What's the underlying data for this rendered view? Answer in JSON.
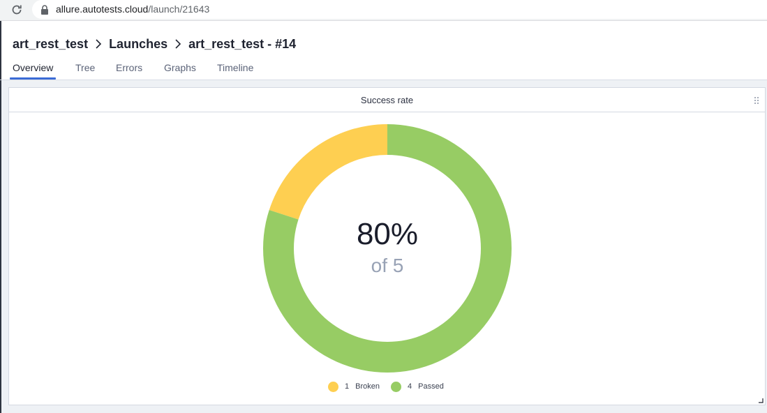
{
  "browser": {
    "url_host": "allure.autotests.cloud",
    "url_path": "/launch/21643"
  },
  "breadcrumb": {
    "items": [
      "art_rest_test",
      "Launches",
      "art_rest_test - #14"
    ]
  },
  "tabs": [
    {
      "label": "Overview",
      "active": true
    },
    {
      "label": "Tree",
      "active": false
    },
    {
      "label": "Errors",
      "active": false
    },
    {
      "label": "Graphs",
      "active": false
    },
    {
      "label": "Timeline",
      "active": false
    }
  ],
  "widget": {
    "title": "Success rate",
    "center_value": "80%",
    "center_sub": "of 5"
  },
  "chart_data": {
    "type": "pie",
    "slices": [
      {
        "name": "Broken",
        "value": 1,
        "color": "#fecf51"
      },
      {
        "name": "Passed",
        "value": 4,
        "color": "#97cc64"
      }
    ],
    "legend": [
      {
        "count": "1",
        "label": "Broken",
        "color": "#fecf51"
      },
      {
        "count": "4",
        "label": "Passed",
        "color": "#97cc64"
      }
    ],
    "legend_placement": "bottom"
  },
  "icons": {
    "reload": "reload-icon",
    "lock": "lock-icon",
    "breadcrumb_separator": "chevron-right-icon",
    "drag": "drag-handle-icon",
    "resize": "resize-handle-icon"
  }
}
